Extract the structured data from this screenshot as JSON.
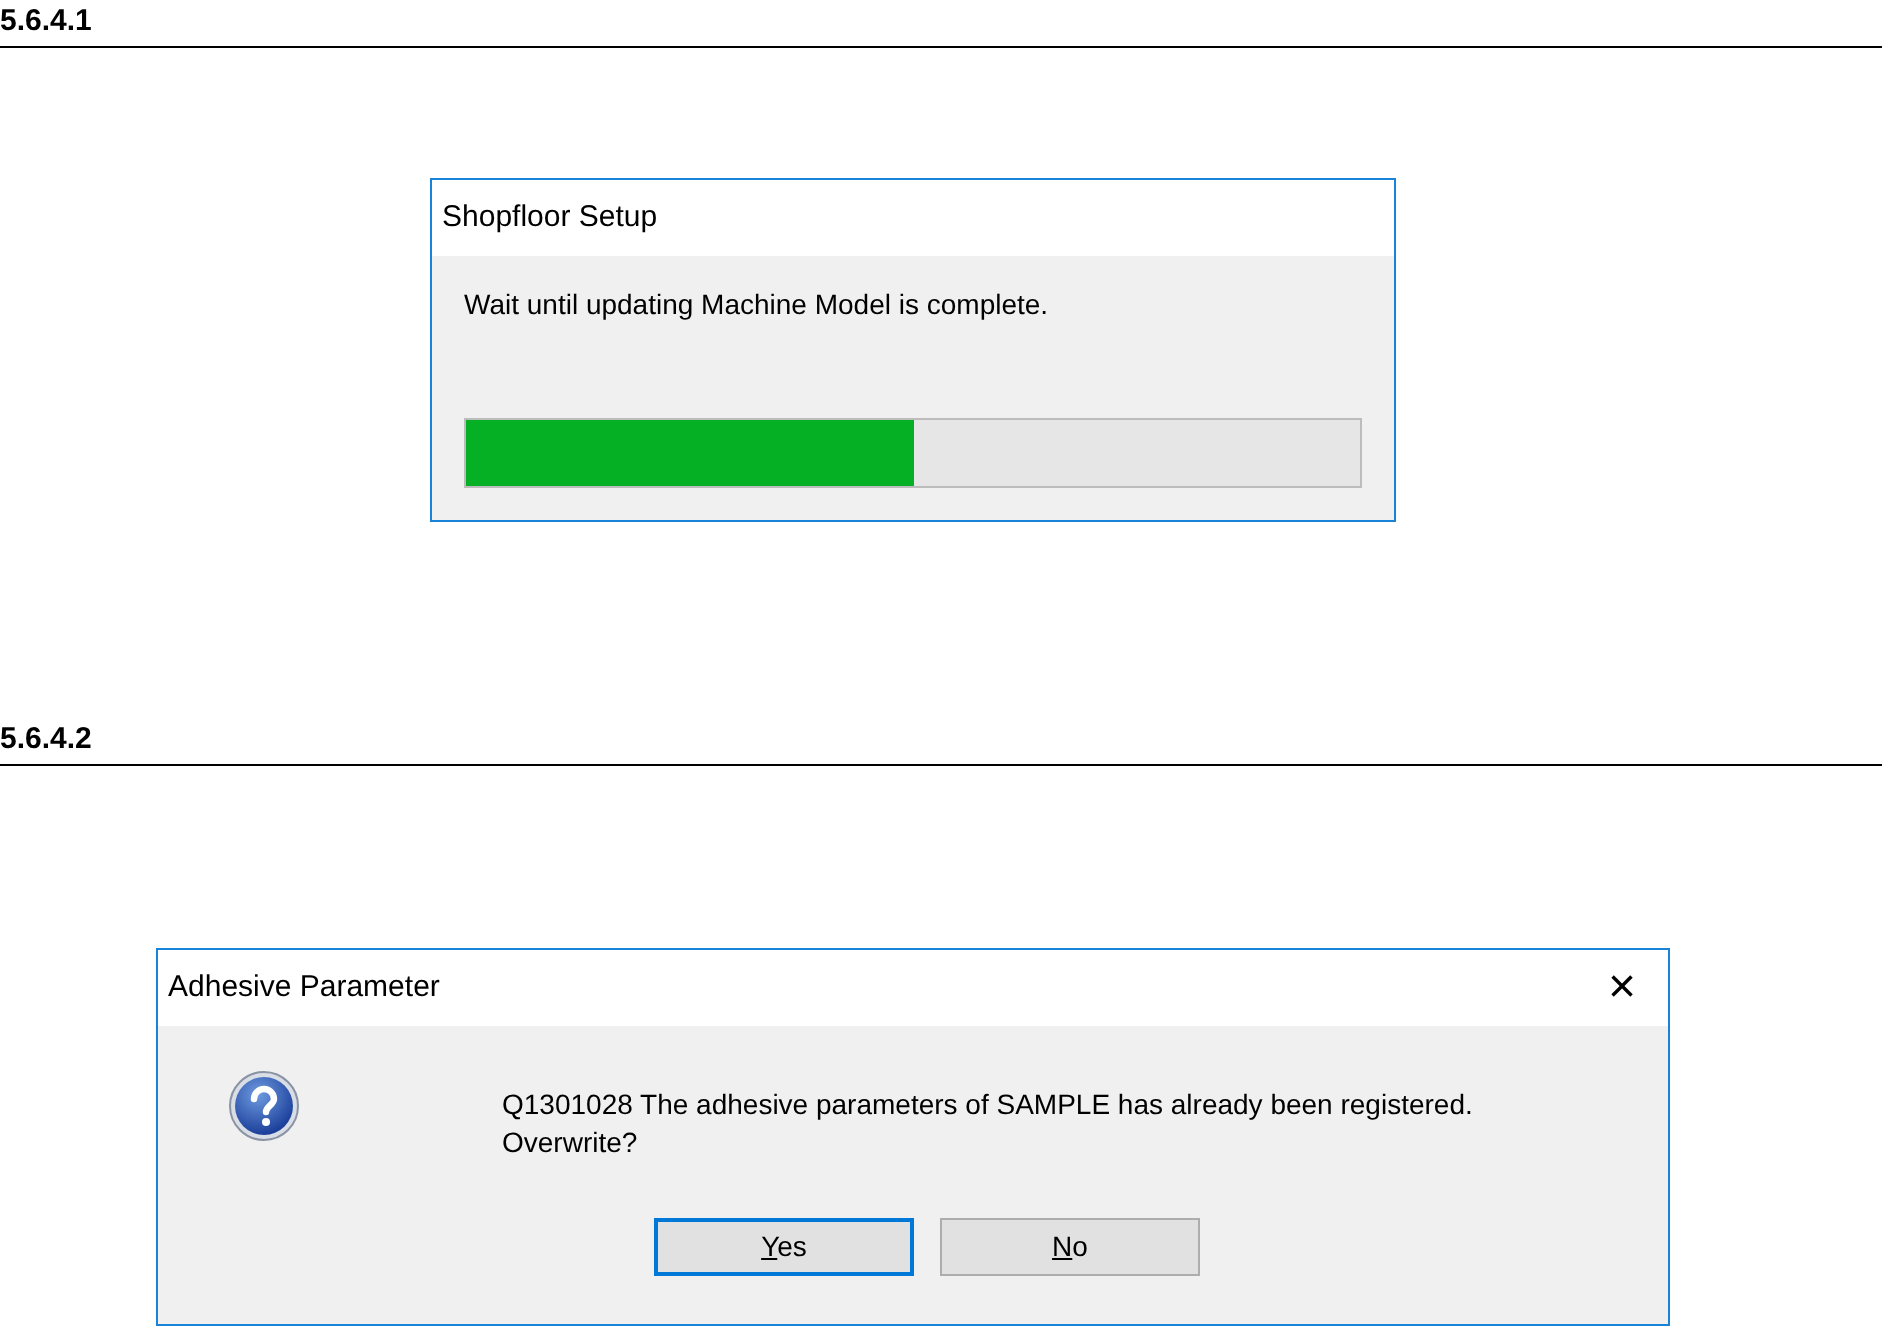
{
  "sections": [
    {
      "heading": "5.6.4.1",
      "dialog": {
        "kind": "progress",
        "title": "Shopfloor Setup",
        "message": "Wait until updating Machine Model is complete.",
        "progress": {
          "level": 0.5
        }
      }
    },
    {
      "heading": "5.6.4.2",
      "dialog": {
        "kind": "question",
        "title": "Adhesive Parameter",
        "close": "×",
        "message": "Q1301028 The adhesive parameters of SAMPLE has already been registered.\nOverwrite?",
        "buttons": [
          {
            "mnemonic": "Y",
            "rest": "es",
            "focused": true
          },
          {
            "mnemonic": "N",
            "rest": "o",
            "focused": false
          }
        ]
      }
    }
  ]
}
